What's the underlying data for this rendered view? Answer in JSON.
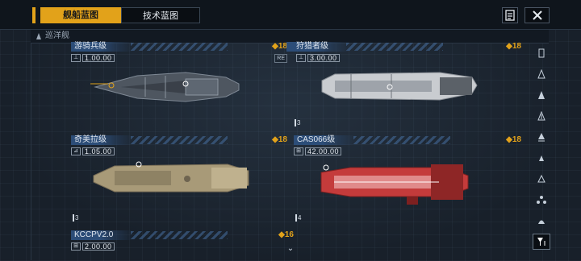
{
  "tabs": {
    "active": "舰船蓝图",
    "inactive": "技术蓝图"
  },
  "section": {
    "title": "巡洋舰"
  },
  "ships": [
    {
      "name": "游骑兵级",
      "rating": "◆18",
      "cost_icon": "⊥",
      "cost": "1.00.00",
      "badge": "RE",
      "level": ""
    },
    {
      "name": "狩猎者级",
      "rating": "◆18",
      "cost_icon": "⊥",
      "cost": "3.00.00",
      "badge": "",
      "level": "3"
    },
    {
      "name": "奇美拉级",
      "rating": "◆18",
      "cost_icon": "⊿",
      "cost": "1.05.00",
      "badge": "",
      "level": "3"
    },
    {
      "name": "CAS066级",
      "rating": "◆18",
      "cost_icon": "⊞",
      "cost": "42.00.00",
      "badge": "",
      "level": "4"
    },
    {
      "name": "KCCPV2.0",
      "rating": "◆16",
      "cost_icon": "⊞",
      "cost": "2.00.00",
      "badge": "",
      "level": ""
    }
  ],
  "icons": {
    "notes": "notebook-icon",
    "close": "close-icon",
    "scroll_down": "chevron-down-icon",
    "filter": "filter-icon"
  },
  "colors": {
    "accent": "#e2a21a",
    "name_bar": "#2c4d78",
    "ship_red": "#c43b3b"
  }
}
